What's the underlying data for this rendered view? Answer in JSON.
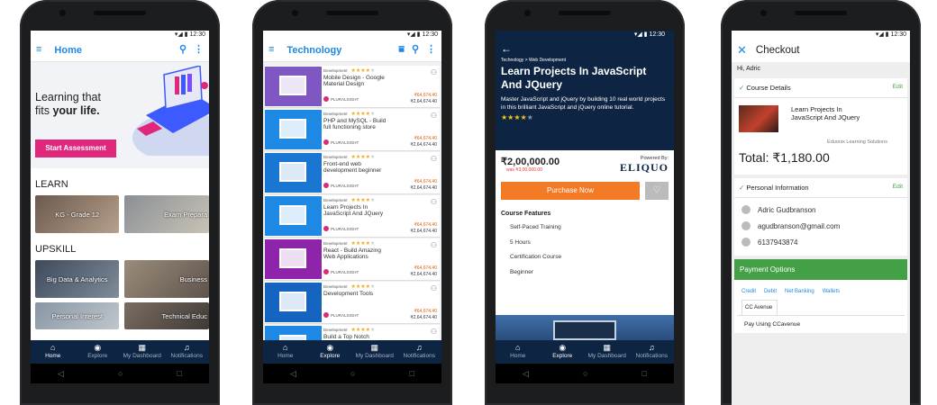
{
  "status_time": "12:30",
  "home": {
    "title": "Home",
    "hero_line1": "Learning that",
    "hero_line2_pre": "fits ",
    "hero_line2_bold": "your life.",
    "cta": "Start Assessment",
    "learn": "LEARN",
    "learn_tiles": [
      "KG - Grade 12",
      "Exam Prepara"
    ],
    "upskill": "UPSKILL",
    "upskill_tiles": [
      "Big Data & Analytics",
      "Business",
      "Personal Interest",
      "Technical Educ"
    ]
  },
  "bottom_nav": [
    "Home",
    "Explore",
    "My Dashboard",
    "Notifications"
  ],
  "tech": {
    "title": "Technology",
    "category": "Development",
    "provider": "PLURALSIGHT",
    "offer_price": "₹64,674.40",
    "orig_price": "₹2,64,674.40",
    "courses": [
      "Mobile Design - Google Material Design",
      "PHP and MySQL - Build full functioning store",
      "Front-end web development beginner",
      "Learn Projects In JavaScript And JQuery",
      "React - Build Amazing Web Applications",
      "Development Tools",
      "Build a Top Notch"
    ]
  },
  "detail": {
    "breadcrumb": "Technology > Web Development",
    "title": "Learn Projects In JavaScript And JQuery",
    "desc": "Master JavaScript and jQuery by building 10 real world projects in this brilliant JavaScript and jQuery online tutorial.",
    "rating": "4 of 5",
    "price": "₹2,00,000.00",
    "was": "was ₹3,00,000.00",
    "powered": "Powered By:",
    "brand": "ELIQUO",
    "buy": "Purchase Now",
    "features_title": "Course Features",
    "features": [
      "Self-Paced Training",
      "5 Hours",
      "Certification Course",
      "Beginner"
    ]
  },
  "checkout": {
    "title": "Checkout",
    "greeting": "Hi, Adric",
    "course_details": "Course Details",
    "edit": "Edit",
    "course_name": "Learn Projects In JavaScript And JQuery",
    "vendor": "Eduonix Learning Solutions",
    "total": "Total: ₹1,180.00",
    "personal": "Personal Information",
    "name": "Adric Gudbranson",
    "email": "agudbranson@gmail.com",
    "phone": "6137943874",
    "payment": "Payment Options",
    "pay_tabs": [
      "Credit",
      "Debit",
      "Net Banking",
      "Wallets"
    ],
    "cc_tab": "CC Avenue",
    "pay_using": "Pay Using CCavenue"
  },
  "colors": {
    "accent": "#1e88e5",
    "pink": "#e0277c",
    "navy": "#0d2542",
    "orange": "#f47b26",
    "green": "#43a047"
  }
}
